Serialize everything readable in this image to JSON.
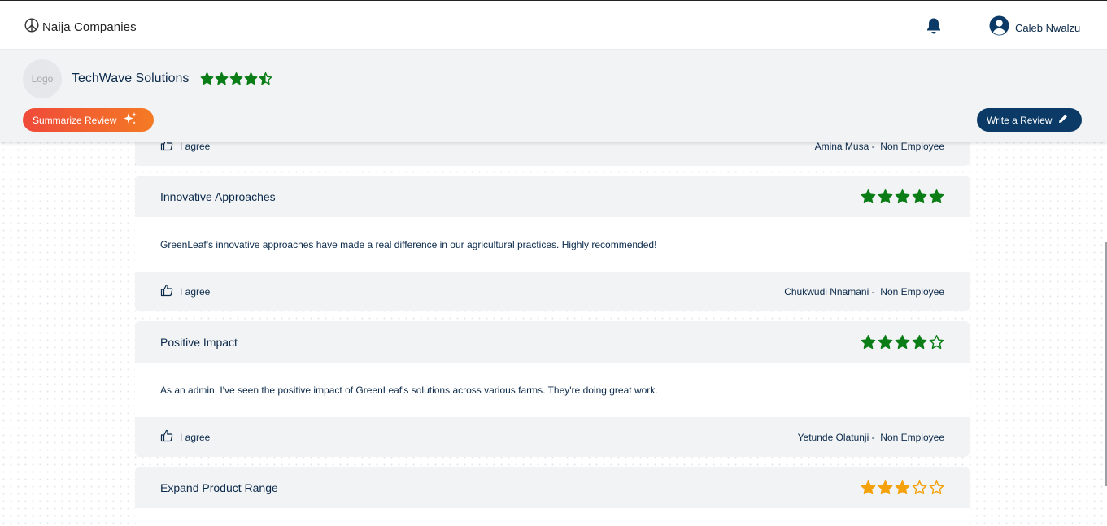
{
  "topbar": {
    "brand": "Naija Companies",
    "icons": {
      "brand": "peace-logo-icon",
      "notifications": "bell-icon",
      "user": "user-circle-icon"
    },
    "user_name": "Caleb Nwalzu"
  },
  "company": {
    "logo_text": "Logo",
    "name": "TechWave Solutions",
    "rating": 4.5,
    "summarize_label": "Summarize Review",
    "summarize_icon": "sparkle-icon",
    "write_label": "Write a Review",
    "write_icon": "pencil-icon"
  },
  "colors": {
    "star_green": "#0a7d16",
    "star_orange": "#f5a10a",
    "navy": "#0b3a66"
  },
  "reviews": [
    {
      "agree_label": "I agree",
      "author": "Amina Musa",
      "role": "Non Employee"
    },
    {
      "title": "Innovative Approaches",
      "rating": 5,
      "star_color": "green",
      "body": "GreenLeaf's innovative approaches have made a real difference in our agricultural practices. Highly recommended!",
      "agree_label": "I agree",
      "author": "Chukwudi Nnamani",
      "role": "Non Employee"
    },
    {
      "title": "Positive Impact",
      "rating": 4,
      "star_color": "green",
      "body": "As an admin, I've seen the positive impact of GreenLeaf's solutions across various farms. They're doing great work.",
      "agree_label": "I agree",
      "author": "Yetunde Olatunji",
      "role": "Non Employee"
    },
    {
      "title": "Expand Product Range",
      "rating": 3,
      "star_color": "orange"
    }
  ]
}
